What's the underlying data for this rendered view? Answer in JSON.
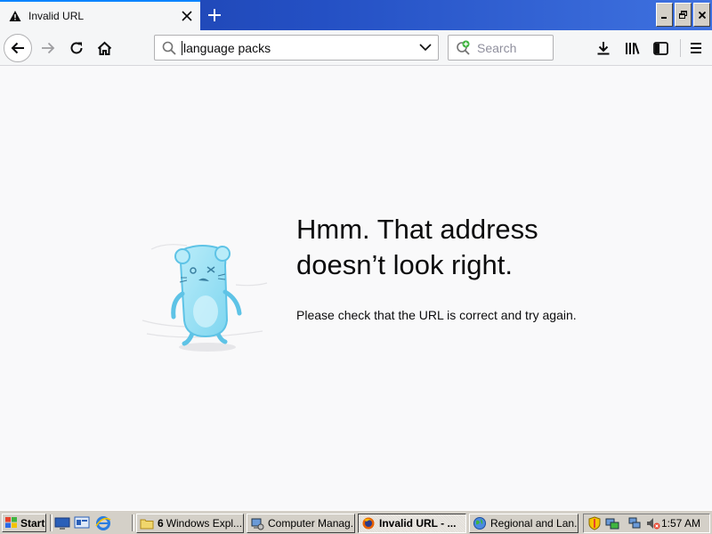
{
  "browser": {
    "tab": {
      "title": "Invalid URL",
      "icon": "warning-icon"
    },
    "url_bar": {
      "value": "language packs",
      "icon": "search-icon"
    },
    "search_bar": {
      "placeholder": "Search",
      "icon": "search-add-icon"
    },
    "toolbar_icons": [
      "back-icon",
      "forward-icon",
      "reload-icon",
      "home-icon",
      "download-icon",
      "library-icon",
      "sidebar-icon",
      "menu-icon"
    ]
  },
  "error_page": {
    "heading_line1": "Hmm. That address",
    "heading_line2": "doesn’t look right.",
    "description": "Please check that the URL is correct and try again."
  },
  "taskbar": {
    "start_label": "Start",
    "quick_launch": [
      "show-desktop-icon",
      "explorer-icon",
      "internet-explorer-icon"
    ],
    "buttons": [
      {
        "label": "6 Windows Expl...",
        "count": "6",
        "text": "Windows Expl...",
        "icon": "folder-icon"
      },
      {
        "label": "Computer Manag...",
        "icon": "computer-management-icon"
      },
      {
        "label": "Invalid URL - ...",
        "icon": "firefox-icon",
        "active": true
      },
      {
        "label": "Regional and Lan...",
        "icon": "globe-icon"
      }
    ],
    "clock": "1:57 AM"
  },
  "colors": {
    "accent": "#0a84ff",
    "titlebar": "#2450c4",
    "taskbar": "#d4d0c8",
    "page_bg": "#f9f9fa"
  }
}
